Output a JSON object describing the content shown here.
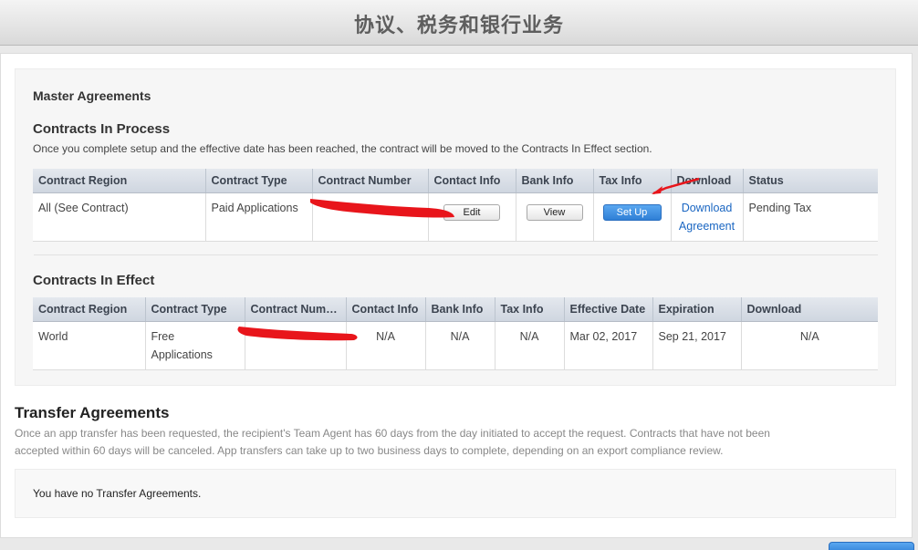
{
  "header": {
    "title": "协议、税务和银行业务"
  },
  "master": {
    "title": "Master Agreements",
    "in_process": {
      "title": "Contracts In Process",
      "description": "Once you complete setup and the effective date has been reached, the contract will be moved to the Contracts In Effect section.",
      "columns": [
        "Contract Region",
        "Contract Type",
        "Contract Number",
        "Contact Info",
        "Bank Info",
        "Tax Info",
        "Download",
        "Status"
      ],
      "row": {
        "region": "All (See Contract)",
        "type": "Paid Applications",
        "number": "",
        "contact_button": "Edit",
        "bank_button": "View",
        "tax_button": "Set Up",
        "download_line1": "Download",
        "download_line2": "Agreement",
        "status": "Pending Tax"
      }
    },
    "in_effect": {
      "title": "Contracts In Effect",
      "columns": [
        "Contract Region",
        "Contract Type",
        "Contract Num…",
        "Contact Info",
        "Bank Info",
        "Tax Info",
        "Effective Date",
        "Expiration",
        "Download"
      ],
      "row": {
        "region": "World",
        "type_line1": "Free",
        "type_line2": "Applications",
        "number": "",
        "contact": "N/A",
        "bank": "N/A",
        "tax": "N/A",
        "effective": "Mar 02, 2017",
        "expiration": "Sep 21, 2017",
        "download": "N/A"
      }
    }
  },
  "transfer": {
    "title": "Transfer Agreements",
    "description_line1": "Once an app transfer has been requested, the recipient's Team Agent has 60 days from the day initiated to accept the request. Contracts that have not been",
    "description_line2": "accepted within 60 days will be canceled. App transfers can take up to two business days to complete, depending on an export compliance review.",
    "empty_message": "You have no Transfer Agreements."
  },
  "colors": {
    "accent": "#2f7fd6",
    "link": "#1a66c2",
    "redaction": "#e8151b"
  }
}
